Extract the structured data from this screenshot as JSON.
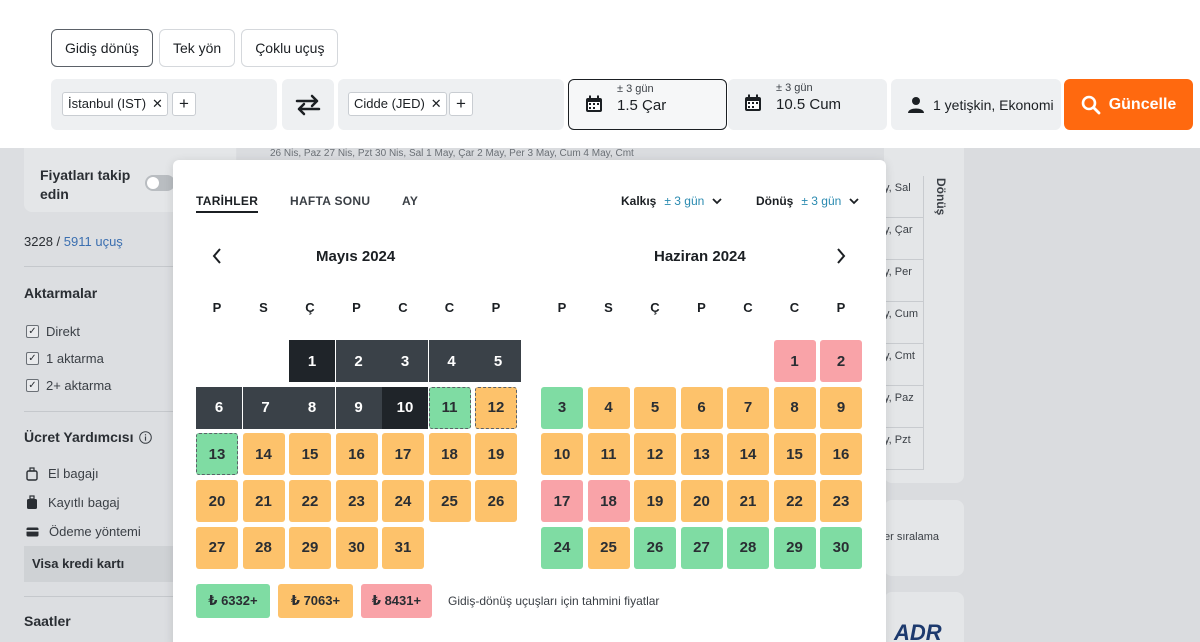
{
  "trip_tabs": [
    "Gidiş dönüş",
    "Tek yön",
    "Çoklu uçuş"
  ],
  "search": {
    "origin": "İstanbul (IST)",
    "destination": "Cidde (JED)",
    "depart_flex": "± 3 gün",
    "depart_date": "1.5 Çar",
    "return_flex": "± 3 gün",
    "return_date": "10.5 Cum",
    "travellers": "1 yetişkin, Ekonomi",
    "update_label": "Güncelle"
  },
  "background": {
    "follow_prices": "Fiyatları takip edin",
    "count_shown": "3228",
    "count_sep": " / ",
    "count_total": "5911 uçuş",
    "stops_title": "Aktarmalar",
    "stops": [
      "Direkt",
      "1 aktarma",
      "2+ aktarma"
    ],
    "fee_title": "Ücret Yardımcısı",
    "fees": [
      "El bagajı",
      "Kayıtlı bagaj",
      "Ödeme yöntemi"
    ],
    "visa": "Visa kredi kartı",
    "times_title": "Saatler",
    "return_vertical": "Dönüş",
    "right_rows": [
      "y, Sal",
      "y, Çar",
      "y, Per",
      "y, Cum",
      "y, Cmt",
      "y, Paz",
      "y, Pzt"
    ],
    "sort_text": "er sıralama",
    "brand": "ADR",
    "top_strip": "26 Nis, Paz      27 Nis, Pzt      30 Nis, Sal      1 May, Çar      2 May, Per      3 May, Cum      4 May, Cmt"
  },
  "calendar": {
    "tabs": [
      "TARİHLER",
      "HAFTA SONU",
      "AY"
    ],
    "depart_label": "Kalkış",
    "depart_flex": "± 3 gün",
    "return_label": "Dönüş",
    "return_flex": "± 3 gün",
    "prev_icon": "chevron-left-icon",
    "next_icon": "chevron-right-icon",
    "weekdays": [
      "P",
      "S",
      "Ç",
      "P",
      "C",
      "C",
      "P"
    ],
    "months": [
      {
        "title": "Mayıs 2024",
        "offset": 2,
        "days": [
          "s",
          "s",
          "s",
          "s",
          "s",
          "s",
          "s",
          "s",
          "s",
          "s",
          "g",
          "o",
          "g",
          "o",
          "o",
          "o",
          "o",
          "o",
          "o",
          "o",
          "o",
          "o",
          "o",
          "o",
          "o",
          "o",
          "o",
          "o",
          "o",
          "o",
          "o"
        ]
      },
      {
        "title": "Haziran 2024",
        "offset": 5,
        "days": [
          "r",
          "r",
          "g",
          "o",
          "o",
          "o",
          "o",
          "o",
          "o",
          "o",
          "o",
          "o",
          "o",
          "o",
          "o",
          "o",
          "r",
          "r",
          "o",
          "o",
          "o",
          "o",
          "o",
          "g",
          "o",
          "g",
          "g",
          "g",
          "g",
          "g"
        ]
      }
    ],
    "legend": [
      {
        "label": "₺ 6332+",
        "color": "#7fdca3"
      },
      {
        "label": "₺ 7063+",
        "color": "#fdc26b"
      },
      {
        "label": "₺ 8431+",
        "color": "#f9a3a8"
      }
    ],
    "legend_note": "Gidiş-dönüş uçuşları için tahmini fiyatlar"
  }
}
